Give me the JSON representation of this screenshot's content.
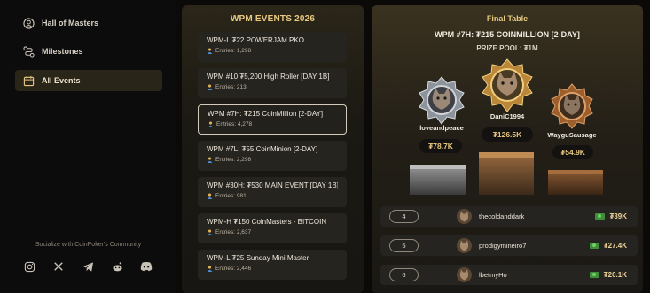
{
  "sidebar": {
    "items": [
      {
        "label": "Hall of Masters",
        "icon": "user-circle-icon",
        "active": false
      },
      {
        "label": "Milestones",
        "icon": "route-icon",
        "active": false
      },
      {
        "label": "All Events",
        "icon": "calendar-icon",
        "active": true
      }
    ],
    "social_label": "Socialize with CoinPoker's Community",
    "socials": [
      "instagram-icon",
      "x-icon",
      "telegram-icon",
      "reddit-icon",
      "discord-icon"
    ]
  },
  "events": {
    "title": "WPM EVENTS 2026",
    "list": [
      {
        "name": "WPM-L ₮22 POWERJAM PKO",
        "entries": "Entries: 1,298",
        "selected": false
      },
      {
        "name": "WPM #10 ₮5,200 High Roller [DAY 1B]",
        "entries": "Entries: 213",
        "selected": false
      },
      {
        "name": "WPM #7H: ₮215 CoinMillion [2-DAY]",
        "entries": "Entries: 4,278",
        "selected": true
      },
      {
        "name": "WPM #7L: ₮55 CoinMinion [2-DAY]",
        "entries": "Entries: 2,298",
        "selected": false
      },
      {
        "name": "WPM #30H: ₮530 MAIN EVENT [DAY 1B]",
        "entries": "Entries: 981",
        "selected": false
      },
      {
        "name": "WPM-H ₮150 CoinMasters - BITCOIN",
        "entries": "Entries: 2,637",
        "selected": false
      },
      {
        "name": "WPM-L ₮25 Sunday Mini Master",
        "entries": "Entries: 2,446",
        "selected": false
      }
    ]
  },
  "final_table": {
    "title": "Final Table",
    "event_name": "WPM #7H: ₮215 COINMILLION [2-DAY]",
    "prize_pool": "PRIZE POOL: ₮1M",
    "podium": [
      {
        "place": 2,
        "name": "loveandpeace",
        "prize": "₮78.7K",
        "medal": "silver"
      },
      {
        "place": 1,
        "name": "DaniC1994",
        "prize": "₮126.5K",
        "medal": "gold"
      },
      {
        "place": 3,
        "name": "WayguSausage",
        "prize": "₮54.9K",
        "medal": "bronze"
      }
    ],
    "rows": [
      {
        "rank": "4",
        "name": "thecoldanddark",
        "prize": "₮39K"
      },
      {
        "rank": "5",
        "name": "prodigymineiro7",
        "prize": "₮27.4K"
      },
      {
        "rank": "6",
        "name": "lbetmyHo",
        "prize": "₮20.1K"
      }
    ]
  },
  "colors": {
    "accent_gold": "#e8c981",
    "active_bg": "#2a2519",
    "silver": "#b9bec4",
    "gold": "#d9a441",
    "bronze": "#b8743a"
  }
}
